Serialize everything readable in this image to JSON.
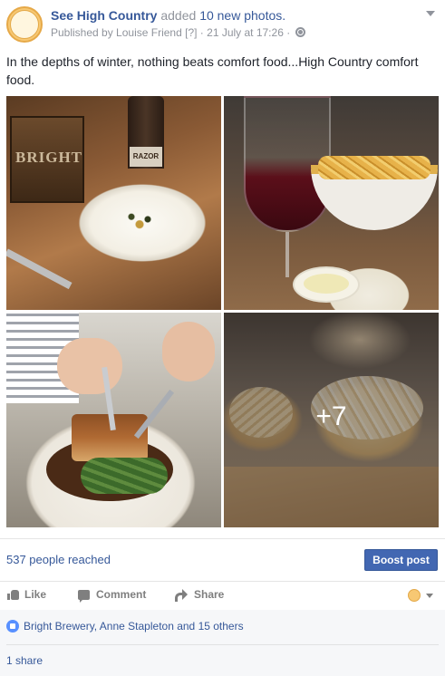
{
  "post": {
    "page_name": "See High Country",
    "added_text": "added",
    "added_count_text": "10 new photos.",
    "published_by": "Published by Louise Friend",
    "help_marker": "[?]",
    "separator": "·",
    "date": "21 July at 17:26",
    "text": "In the depths of winter, nothing beats comfort food...High Country comfort food."
  },
  "photos": {
    "crate_label": "BRIGHT",
    "bottle_label": "RAZOR",
    "more_count": "+7"
  },
  "reach": {
    "reached_text": "537 people reached",
    "boost_label": "Boost post"
  },
  "actions": {
    "like": "Like",
    "comment": "Comment",
    "share": "Share"
  },
  "summary": {
    "likes": "Bright Brewery, Anne Stapleton and 15 others",
    "shares": "1 share"
  },
  "colors": {
    "link": "#365899",
    "boost": "#4267b2",
    "muted": "#90949c"
  }
}
